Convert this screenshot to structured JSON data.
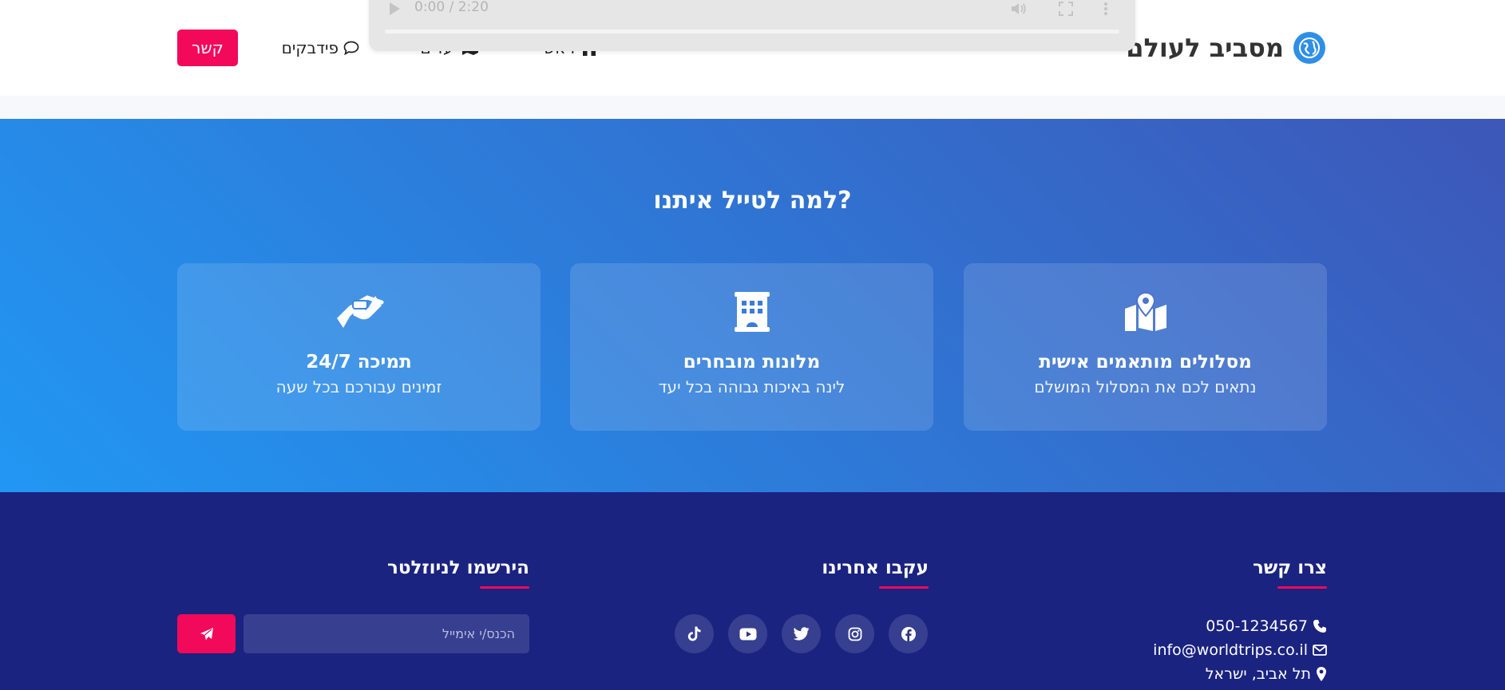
{
  "header": {
    "brand_name": "מסביב לעולם",
    "nav": {
      "home_label": "ראשי",
      "destinations_label": "יעדים",
      "feedback_label": "פידבקים"
    },
    "contact_button_label": "קשר"
  },
  "video_player": {
    "time": "0:00 / 2:20"
  },
  "features": {
    "title": "למה לטייל איתנו?",
    "cards": [
      {
        "icon": "map-location-icon",
        "title": "מסלולים מותאמים אישית",
        "text": "נתאים לכם את המסלול המושלם"
      },
      {
        "icon": "hotel-icon",
        "title": "מלונות מובחרים",
        "text": "לינה באיכות גבוהה בכל יעד"
      },
      {
        "icon": "handshake-icon",
        "title": "תמיכה 24/7",
        "text": "זמינים עבורכם בכל שעה"
      }
    ]
  },
  "footer": {
    "contact": {
      "title": "צרו קשר",
      "phone": "050-1234567",
      "email": "info@worldtrips.co.il",
      "address": "תל אביב, ישראל"
    },
    "follow": {
      "title": "עקבו אחרינו",
      "networks": [
        "facebook",
        "instagram",
        "twitter",
        "youtube",
        "tiktok"
      ]
    },
    "newsletter": {
      "title": "הירשמו לניוזלטר",
      "placeholder": "הכנס/י אימייל"
    }
  },
  "colors": {
    "accent": "#f2095a",
    "brand_blue": "#2f8fe6",
    "gradient_start": "#2197f3",
    "gradient_end": "#3d57b8",
    "footer_bg": "#1a2380"
  }
}
